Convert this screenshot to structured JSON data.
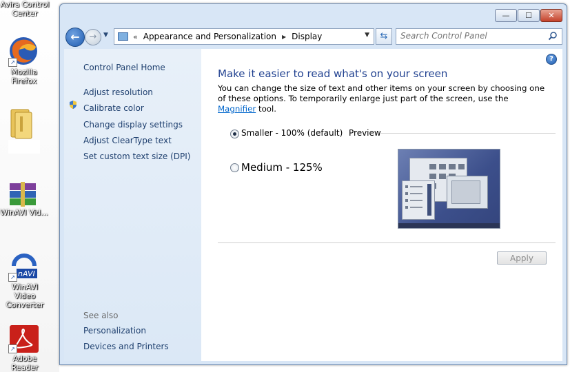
{
  "desktop": {
    "icons": [
      {
        "label": "Avira Control Center",
        "icon": "avira-icon"
      },
      {
        "label": "Mozilla Firefox",
        "icon": "firefox-icon"
      },
      {
        "label": "",
        "icon": "folder-icon"
      },
      {
        "label": "WinAVI Vid...",
        "icon": "winrar-icon"
      },
      {
        "label": "WinAVI Video Converter",
        "icon": "winavi-icon"
      },
      {
        "label": "Adobe Reader",
        "icon": "adobe-reader-icon"
      }
    ],
    "partial_text": "Avira Control Center"
  },
  "window": {
    "controls": {
      "minimize": "—",
      "maximize": "☐",
      "close": "✕"
    }
  },
  "navbar": {
    "back": "back-icon",
    "forward": "forward-icon",
    "breadcrumb": [
      "Appearance and Personalization",
      "Display"
    ],
    "breadcrumb_prefix": "«",
    "search_placeholder": "Search Control Panel"
  },
  "sidebar": {
    "home": "Control Panel Home",
    "tasks": [
      {
        "label": "Adjust resolution",
        "icon": null
      },
      {
        "label": "Calibrate color",
        "icon": "shield-icon"
      },
      {
        "label": "Change display settings",
        "icon": null
      },
      {
        "label": "Adjust ClearType text",
        "icon": null
      },
      {
        "label": "Set custom text size (DPI)",
        "icon": null
      }
    ],
    "see_also": "See also",
    "related": [
      "Personalization",
      "Devices and Printers"
    ]
  },
  "main": {
    "heading": "Make it easier to read what's on your screen",
    "description_1": "You can change the size of text and other items on your screen by choosing one of these options. To temporarily enlarge just part of the screen, use the",
    "magnifier_link": "Magnifier",
    "description_2": "tool.",
    "options": [
      {
        "label": "Smaller - 100% (default)",
        "selected": true
      },
      {
        "label": "Medium - 125%",
        "selected": false
      }
    ],
    "preview_label": "Preview",
    "apply": "Apply"
  }
}
